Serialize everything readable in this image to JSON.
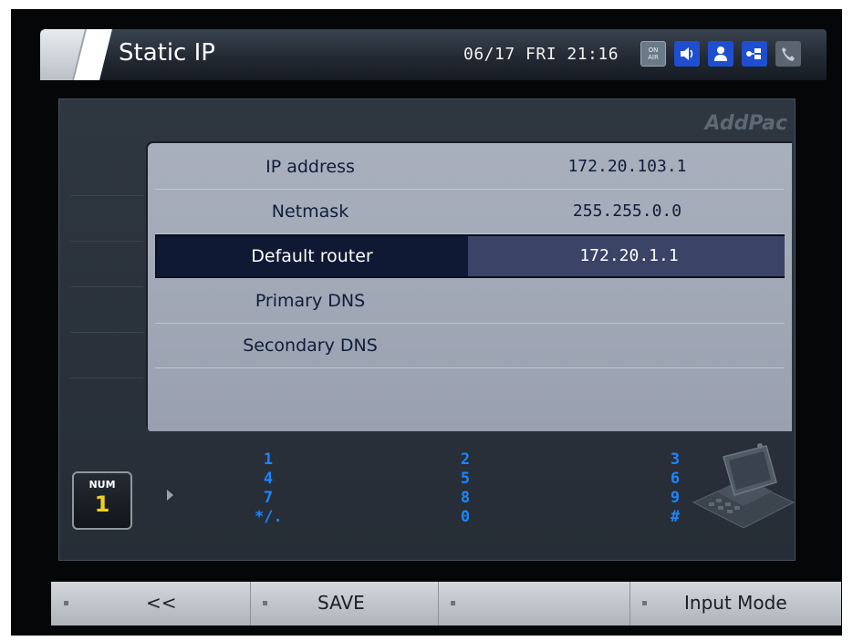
{
  "header": {
    "title": "Static IP",
    "datetime": "06/17 FRI 21:16",
    "onair_icon_text": "ON\nAIR",
    "status_icons": [
      "on-air-icon",
      "speaker-icon",
      "user-icon",
      "network-icon",
      "phone-icon"
    ]
  },
  "brand": "AddPac",
  "settings": {
    "rows": [
      {
        "label": "IP address",
        "value": "172.20.103.1"
      },
      {
        "label": "Netmask",
        "value": "255.255.0.0"
      },
      {
        "label": "Default router",
        "value": "172.20.1.1",
        "selected": true
      },
      {
        "label": "Primary DNS",
        "value": ""
      },
      {
        "label": "Secondary DNS",
        "value": ""
      }
    ]
  },
  "input_mode": {
    "label": "NUM",
    "value": "1"
  },
  "keypad": {
    "col1": [
      "1",
      "4",
      "7",
      "*/."
    ],
    "col2": [
      "2",
      "5",
      "8",
      "0"
    ],
    "col3": [
      "3",
      "6",
      "9",
      "#"
    ]
  },
  "softkeys": [
    "<<",
    "SAVE",
    "",
    "Input Mode"
  ],
  "colors": {
    "accent_blue": "#1a86ff",
    "selected_row": "#101934",
    "table_bg": "#a9b0bd"
  }
}
